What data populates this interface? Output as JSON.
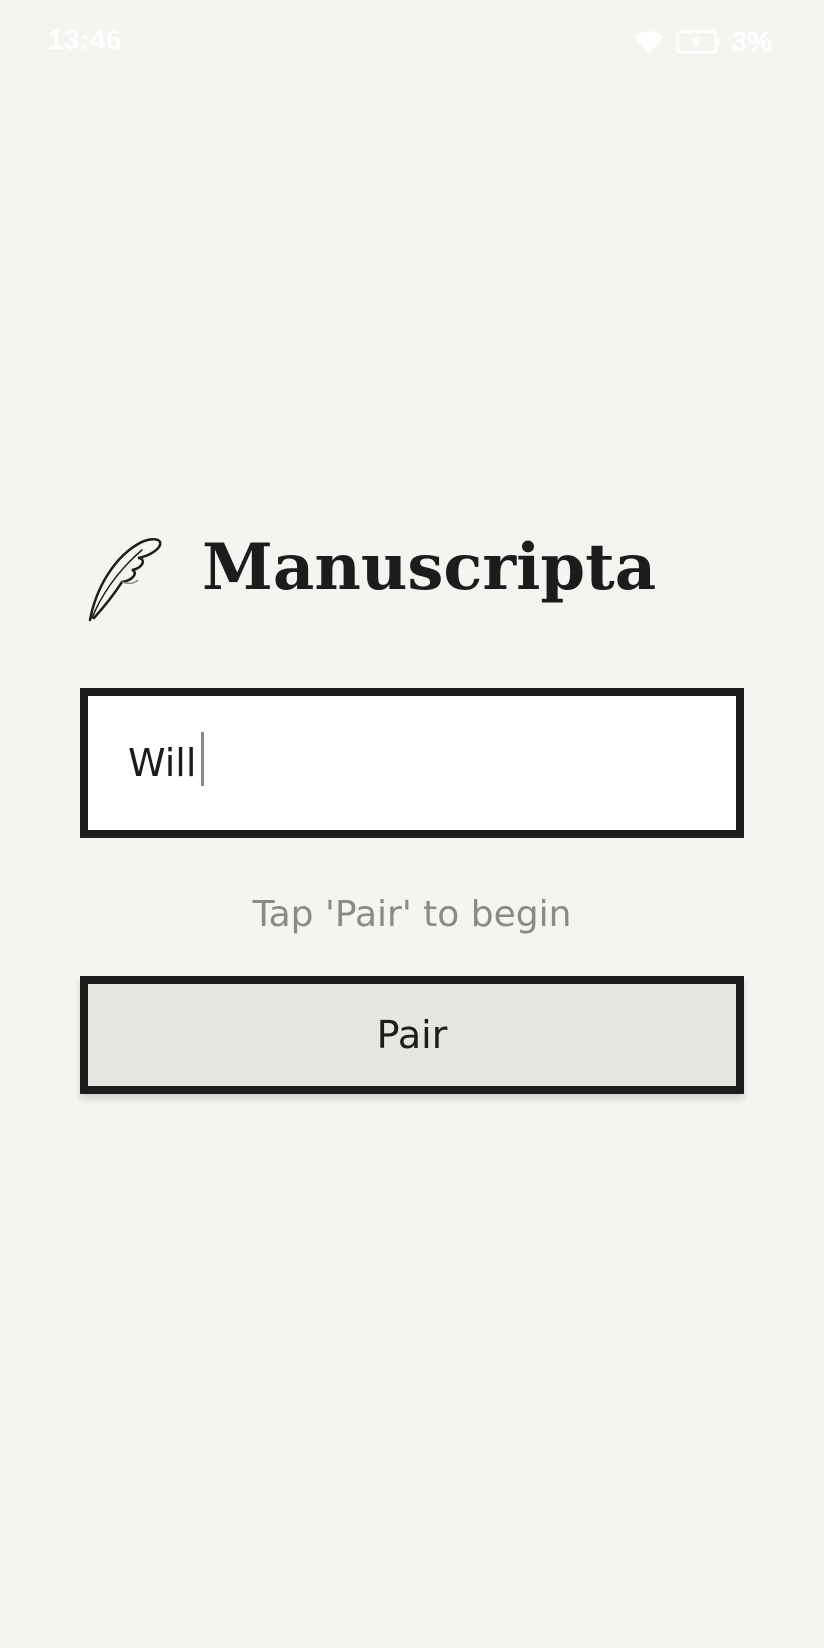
{
  "status_bar": {
    "time": "13:46",
    "battery_percent": "3%",
    "icons": [
      "wifi-icon",
      "battery-charging-icon"
    ]
  },
  "brand": {
    "title": "Manuscripta",
    "logo_icon": "quill-icon"
  },
  "name_input": {
    "value": "Will"
  },
  "hint": "Tap 'Pair' to begin",
  "pair_button": {
    "label": "Pair"
  },
  "colors": {
    "background": "#f4f4f0",
    "ink": "#1c1c1c",
    "hint_text": "#8a8a86",
    "button_fill": "#e7e5e0",
    "input_fill": "#ffffff"
  }
}
